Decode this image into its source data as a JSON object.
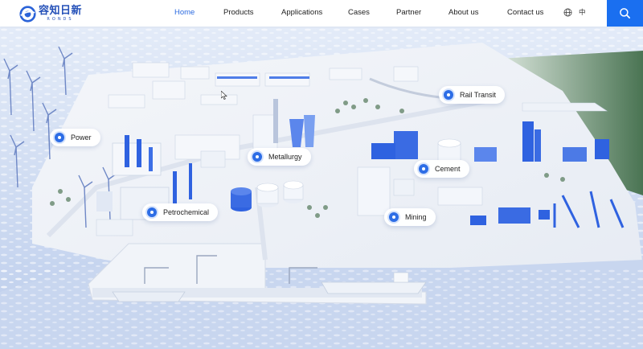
{
  "brand": {
    "name_cn": "容知日新",
    "name_en": "RONDS",
    "color": "#2450b8"
  },
  "nav": {
    "items": [
      {
        "label": "Home",
        "active": true
      },
      {
        "label": "Products",
        "active": false
      },
      {
        "label": "Applications",
        "active": false
      },
      {
        "label": "Cases",
        "active": false
      },
      {
        "label": "Partner",
        "active": false
      },
      {
        "label": "About us",
        "active": false
      },
      {
        "label": "Contact us",
        "active": false
      }
    ],
    "language": "中",
    "language_icon": "globe-icon",
    "search_icon": "search-icon",
    "accent_color": "#1a6ff0"
  },
  "hero": {
    "hotspots": [
      {
        "label": "Power"
      },
      {
        "label": "Metallurgy"
      },
      {
        "label": "Rail Transit"
      },
      {
        "label": "Cement"
      },
      {
        "label": "Petrochemical"
      },
      {
        "label": "Mining"
      }
    ]
  },
  "colors": {
    "sea": "#c7d6f2",
    "land": "#eef1f6",
    "equipment_blue": "#2f62e0",
    "forest": "#4f7a58"
  }
}
